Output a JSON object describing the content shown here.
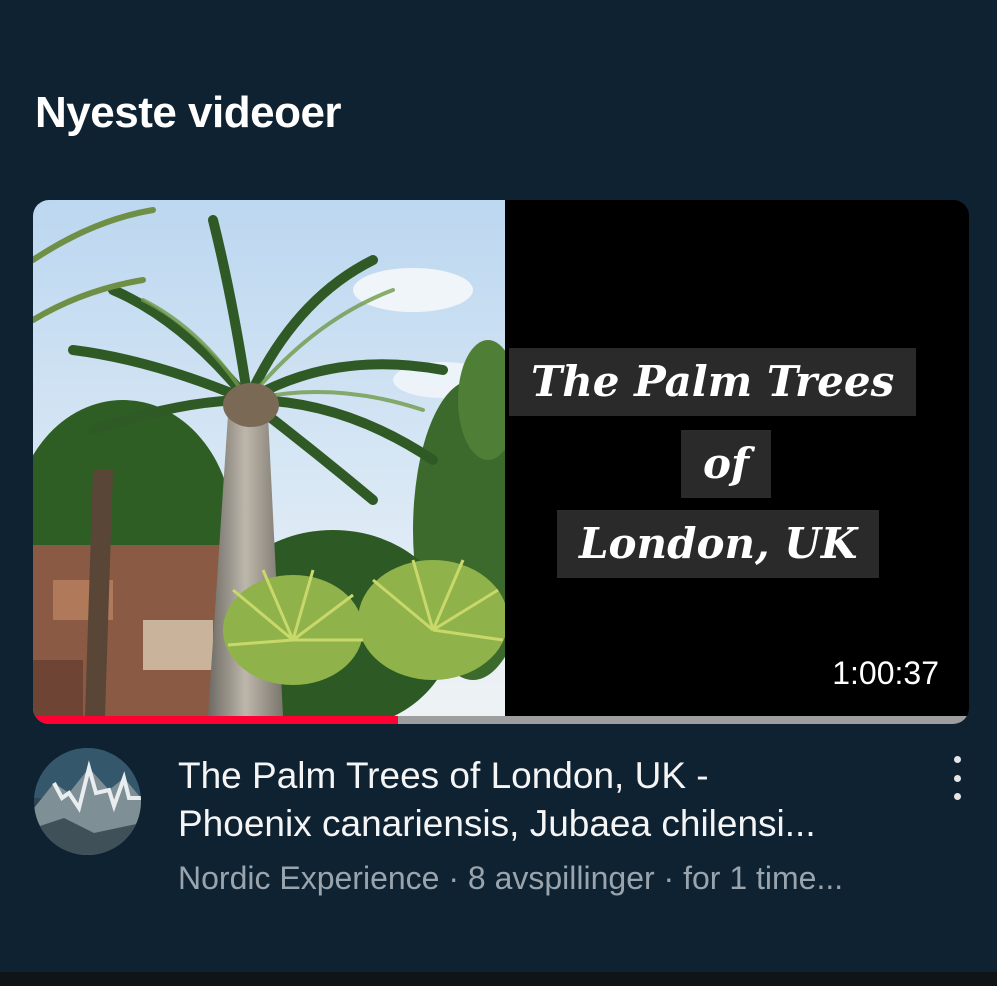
{
  "section": {
    "title": "Nyeste videoer"
  },
  "video": {
    "thumbnail": {
      "title_lines": [
        "The Palm Trees",
        "of",
        "London, UK"
      ],
      "duration": "1:00:37",
      "watch_progress": 0.39
    },
    "title_line1": "The Palm Trees of London, UK -",
    "title_line2": "Phoenix canariensis, Jubaea chilensi...",
    "channel": "Nordic Experience",
    "separator": "·",
    "views": "8 avspillinger",
    "age": "for 1 time..."
  },
  "icons": {
    "more": "more-vert-icon",
    "avatar": "mountain-avatar"
  },
  "colors": {
    "background": "#0f2232",
    "progress": "#ff0033"
  }
}
